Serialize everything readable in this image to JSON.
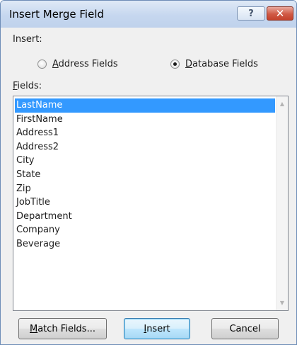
{
  "window": {
    "title": "Insert Merge Field",
    "help_glyph": "?",
    "close_glyph": "✕"
  },
  "insert": {
    "label": "Insert:",
    "options": [
      {
        "prefix": "",
        "accel": "A",
        "rest": "ddress Fields",
        "selected": false
      },
      {
        "prefix": "",
        "accel": "D",
        "rest": "atabase Fields",
        "selected": true
      }
    ]
  },
  "fields": {
    "label_accel": "F",
    "label_rest": "ields:",
    "items": [
      "LastName",
      "FirstName",
      "Address1",
      "Address2",
      "City",
      "State",
      "Zip",
      "JobTitle",
      "Department",
      "Company",
      "Beverage"
    ],
    "selected_index": 0
  },
  "buttons": {
    "match": {
      "accel": "M",
      "rest": "atch Fields..."
    },
    "insert": {
      "accel": "I",
      "rest": "nsert"
    },
    "cancel": "Cancel"
  },
  "colors": {
    "selection": "#3399ff",
    "titlebar": "#c6d7ef",
    "close": "#c4412b"
  }
}
